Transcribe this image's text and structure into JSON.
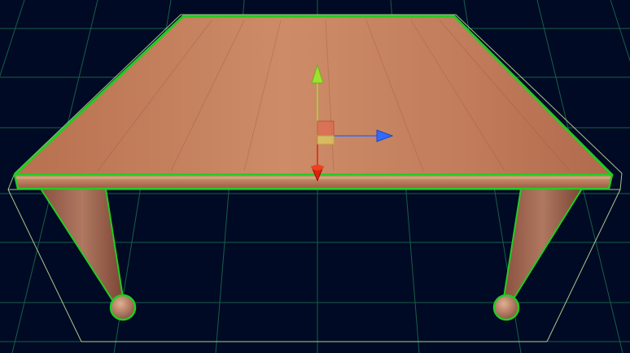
{
  "scene": {
    "background_color": "#000a24",
    "grid_color": "#1f7a55",
    "selection_outline_color": "#22cc22",
    "bounding_box_color": "#c8e6a0",
    "wood_colors": [
      "#b8704f",
      "#c98a66",
      "#a8614a"
    ],
    "selected_object": "table"
  },
  "gizmo": {
    "type": "move-tool",
    "axes": [
      {
        "axis": "x",
        "color": "#2f6bff"
      },
      {
        "axis": "y",
        "color": "#9fe030"
      },
      {
        "axis": "z",
        "color": "#e02010"
      }
    ],
    "plane_handle_colors": [
      "#e06a50",
      "#e0d060"
    ]
  }
}
